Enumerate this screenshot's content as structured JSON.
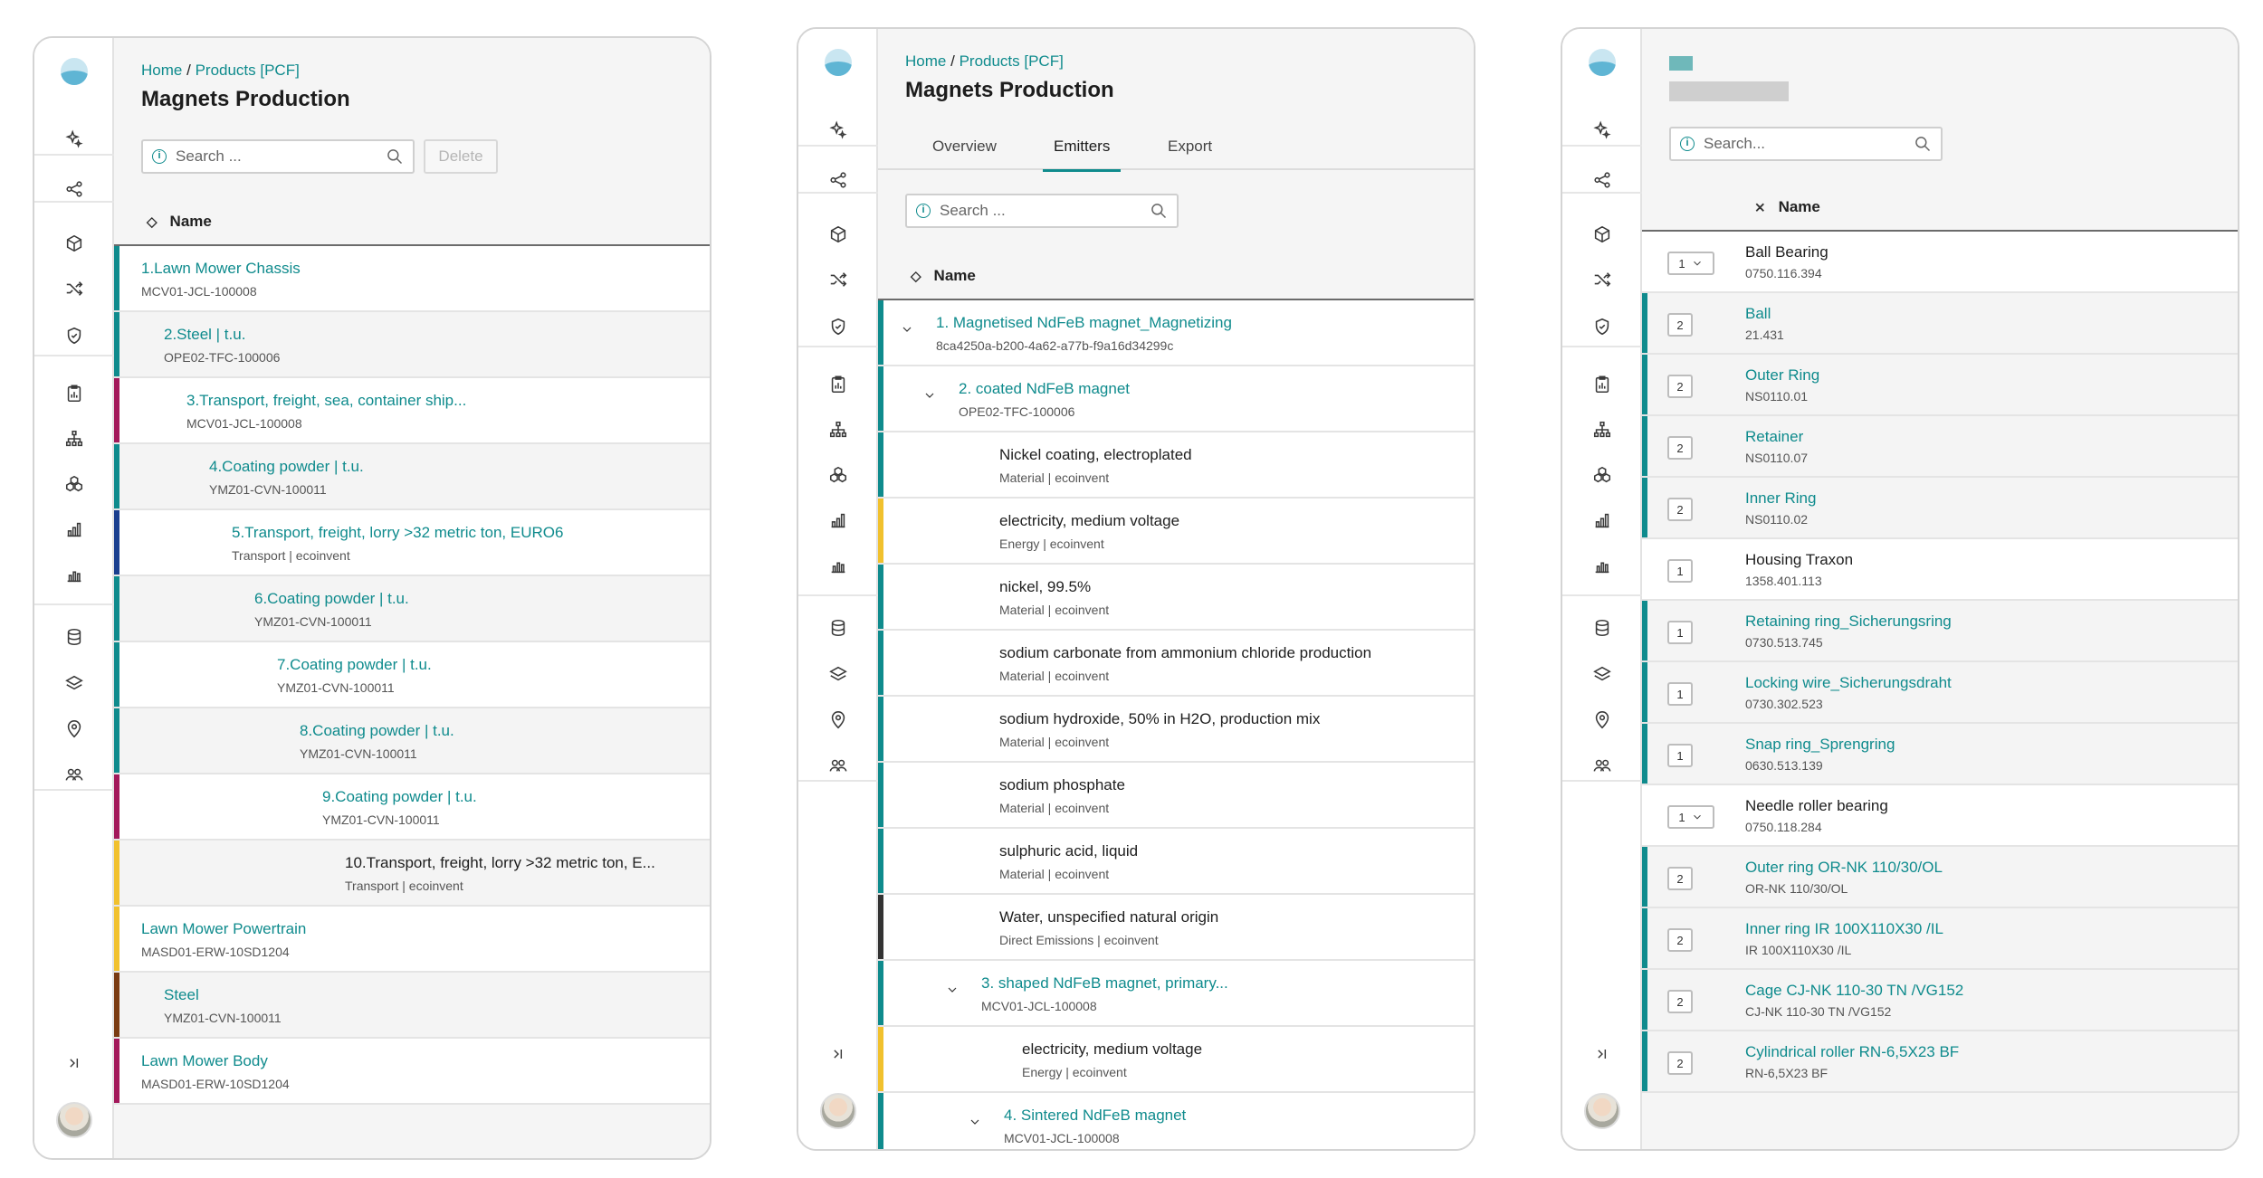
{
  "colors": {
    "teal": "#0f8b8d",
    "crimson": "#a3195b",
    "navy": "#1a3f8f",
    "yellow": "#f1c12e",
    "brown": "#7a3b12",
    "charcoal": "#333333"
  },
  "rail_icons": [
    "ai-sparkle-icon",
    "share-icon",
    "cube-icon",
    "shuffle-icon",
    "shield-icon",
    "clipboard-chart-icon",
    "hierarchy-icon",
    "cubes-icon",
    "bar-chart-icon",
    "column-chart-icon",
    "database-icon",
    "layers-icon",
    "location-pin-icon",
    "users-icon",
    "expand-sidebar-icon"
  ],
  "panel1": {
    "breadcrumb": {
      "home": "Home",
      "sep": "/",
      "products": "Products [PCF]"
    },
    "title": "Magnets Production",
    "search_placeholder": "Search ...",
    "delete_label": "Delete",
    "column_name": "Name",
    "rows": [
      {
        "name": "1.Lawn Mower Chassis",
        "sub": "MCV01-JCL-100008",
        "color": "teal",
        "indent": 0,
        "link": true
      },
      {
        "name": "2.Steel | t.u.",
        "sub": "OPE02-TFC-100006",
        "color": "teal",
        "indent": 1,
        "link": true
      },
      {
        "name": "3.Transport, freight, sea, container ship...",
        "sub": "MCV01-JCL-100008",
        "color": "crimson",
        "indent": 2,
        "link": true
      },
      {
        "name": "4.Coating powder | t.u.",
        "sub": "YMZ01-CVN-100011",
        "color": "teal",
        "indent": 3,
        "link": true
      },
      {
        "name": "5.Transport, freight, lorry >32 metric ton, EURO6",
        "sub": "Transport | ecoinvent",
        "color": "navy",
        "indent": 4,
        "link": true
      },
      {
        "name": "6.Coating powder | t.u.",
        "sub": "YMZ01-CVN-100011",
        "color": "teal",
        "indent": 5,
        "link": true
      },
      {
        "name": "7.Coating powder | t.u.",
        "sub": "YMZ01-CVN-100011",
        "color": "teal",
        "indent": 6,
        "link": true
      },
      {
        "name": "8.Coating powder | t.u.",
        "sub": "YMZ01-CVN-100011",
        "color": "teal",
        "indent": 7,
        "link": true
      },
      {
        "name": "9.Coating powder | t.u.",
        "sub": "YMZ01-CVN-100011",
        "color": "crimson",
        "indent": 8,
        "link": true
      },
      {
        "name": "10.Transport, freight, lorry >32 metric ton, E...",
        "sub": "Transport | ecoinvent",
        "color": "yellow",
        "indent": 9,
        "link": false
      },
      {
        "name": "Lawn Mower Powertrain",
        "sub": "MASD01-ERW-10SD1204",
        "color": "yellow",
        "indent": 0,
        "link": true
      },
      {
        "name": "Steel",
        "sub": "YMZ01-CVN-100011",
        "color": "brown",
        "indent": 1,
        "link": true
      },
      {
        "name": "Lawn Mower Body",
        "sub": "MASD01-ERW-10SD1204",
        "color": "crimson",
        "indent": 0,
        "link": true
      }
    ]
  },
  "panel2": {
    "breadcrumb": {
      "home": "Home",
      "sep": "/",
      "products": "Products [PCF]"
    },
    "title": "Magnets Production",
    "tabs": [
      "Overview",
      "Emitters",
      "Export"
    ],
    "search_placeholder": "Search ...",
    "column_name": "Name",
    "rows": [
      {
        "name": "1. Magnetised NdFeB magnet_Magnetizing",
        "sub": "8ca4250a-b200-4a62-a77b-f9a16d34299c",
        "color": "teal",
        "indent": 0,
        "chevron": true,
        "link": true
      },
      {
        "name": "2. coated NdFeB magnet",
        "sub": "OPE02-TFC-100006",
        "color": "teal",
        "indent": 1,
        "chevron": true,
        "link": true
      },
      {
        "name": "Nickel coating, electroplated",
        "sub": "Material | ecoinvent",
        "color": "teal",
        "indent": 2,
        "chevron": false,
        "link": false
      },
      {
        "name": "electricity, medium voltage",
        "sub": "Energy | ecoinvent",
        "color": "yellow",
        "indent": 2,
        "chevron": false,
        "link": false
      },
      {
        "name": "nickel, 99.5%",
        "sub": "Material | ecoinvent",
        "color": "teal",
        "indent": 2,
        "chevron": false,
        "link": false
      },
      {
        "name": "sodium carbonate from ammonium chloride production",
        "sub": "Material | ecoinvent",
        "color": "teal",
        "indent": 2,
        "chevron": false,
        "link": false
      },
      {
        "name": "sodium hydroxide, 50% in H2O, production mix",
        "sub": "Material | ecoinvent",
        "color": "teal",
        "indent": 2,
        "chevron": false,
        "link": false
      },
      {
        "name": "sodium phosphate",
        "sub": "Material | ecoinvent",
        "color": "teal",
        "indent": 2,
        "chevron": false,
        "link": false
      },
      {
        "name": "sulphuric acid, liquid",
        "sub": "Material | ecoinvent",
        "color": "teal",
        "indent": 2,
        "chevron": false,
        "link": false
      },
      {
        "name": "Water, unspecified natural origin",
        "sub": "Direct Emissions | ecoinvent",
        "color": "charcoal",
        "indent": 2,
        "chevron": false,
        "link": false
      },
      {
        "name": "3. shaped NdFeB magnet, primary...",
        "sub": "MCV01-JCL-100008",
        "color": "teal",
        "indent": 2,
        "chevron": true,
        "link": true
      },
      {
        "name": "electricity, medium voltage",
        "sub": "Energy | ecoinvent",
        "color": "yellow",
        "indent": 3,
        "chevron": false,
        "link": false
      },
      {
        "name": "4. Sintered NdFeB magnet",
        "sub": "MCV01-JCL-100008",
        "color": "teal",
        "indent": 3,
        "chevron": true,
        "link": true
      }
    ]
  },
  "panel3": {
    "search_placeholder": "Search...",
    "column_name": "Name",
    "rows": [
      {
        "qty": "1",
        "dropdown": true,
        "name": "Ball Bearing",
        "sub": "0750.116.394",
        "color": "",
        "link": false
      },
      {
        "qty": "2",
        "dropdown": false,
        "name": "Ball",
        "sub": "21.431",
        "color": "teal",
        "link": true
      },
      {
        "qty": "2",
        "dropdown": false,
        "name": "Outer Ring",
        "sub": "NS0110.01",
        "color": "teal",
        "link": true
      },
      {
        "qty": "2",
        "dropdown": false,
        "name": "Retainer",
        "sub": "NS0110.07",
        "color": "teal",
        "link": true
      },
      {
        "qty": "2",
        "dropdown": false,
        "name": "Inner Ring",
        "sub": "NS0110.02",
        "color": "teal",
        "link": true
      },
      {
        "qty": "1",
        "dropdown": false,
        "name": "Housing Traxon",
        "sub": "1358.401.113",
        "color": "",
        "link": false
      },
      {
        "qty": "1",
        "dropdown": false,
        "name": "Retaining ring_Sicherungsring",
        "sub": "0730.513.745",
        "color": "teal",
        "link": true
      },
      {
        "qty": "1",
        "dropdown": false,
        "name": "Locking wire_Sicherungsdraht",
        "sub": "0730.302.523",
        "color": "teal",
        "link": true
      },
      {
        "qty": "1",
        "dropdown": false,
        "name": "Snap ring_Sprengring",
        "sub": "0630.513.139",
        "color": "teal",
        "link": true
      },
      {
        "qty": "1",
        "dropdown": true,
        "name": "Needle roller bearing",
        "sub": "0750.118.284",
        "color": "",
        "link": false
      },
      {
        "qty": "2",
        "dropdown": false,
        "name": "Outer ring OR-NK 110/30/OL",
        "sub": "OR-NK 110/30/OL",
        "color": "teal",
        "link": true
      },
      {
        "qty": "2",
        "dropdown": false,
        "name": "Inner ring IR 100X110X30 /IL",
        "sub": "IR 100X110X30 /IL",
        "color": "teal",
        "link": true
      },
      {
        "qty": "2",
        "dropdown": false,
        "name": "Cage CJ-NK 110-30 TN /VG152",
        "sub": "CJ-NK 110-30 TN /VG152",
        "color": "teal",
        "link": true
      },
      {
        "qty": "2",
        "dropdown": false,
        "name": "Cylindrical roller RN-6,5X23 BF",
        "sub": "RN-6,5X23 BF",
        "color": "teal",
        "link": true
      }
    ]
  }
}
